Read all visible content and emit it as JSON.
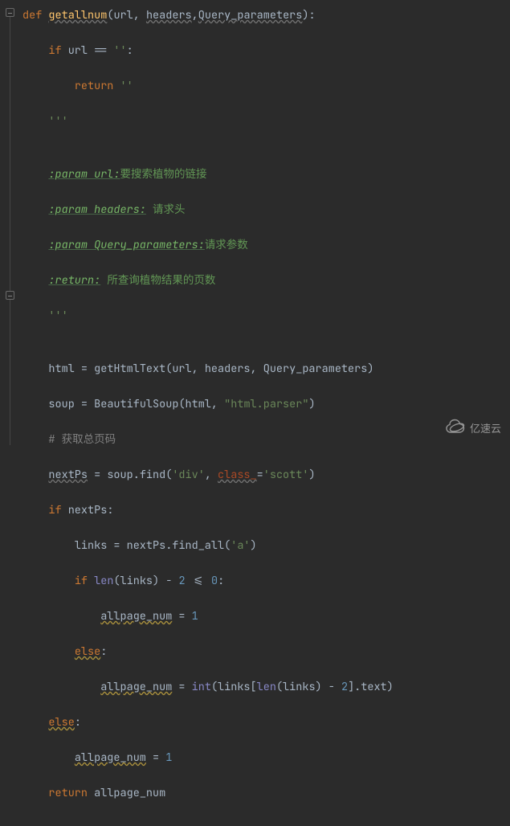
{
  "code": {
    "def": "def",
    "fn_name": "getallnum",
    "lp": "(",
    "p1": "url",
    "c1": ", ",
    "p2": "headers",
    "c2": ",",
    "p3": "Query_parameters",
    "rp": ")",
    "colon": ":",
    "if1_kw": "if",
    "if1_var": " url ",
    "if1_eq": "==",
    "if1_empty": " ''",
    "if1_colon": ":",
    "ret1_kw": "return",
    "ret1_val": " ''",
    "tq_open": "'''",
    "doc_l1_tag": ":param url:",
    "doc_l1_txt": "要搜索植物的链接",
    "doc_l2_tag": ":param headers:",
    "doc_l2_txt": " 请求头",
    "doc_l3_tag": ":param Query_parameters:",
    "doc_l3_txt": "请求参数",
    "doc_l4_tag": ":return:",
    "doc_l4_txt": " 所查询植物结果的页数",
    "tq_close": "'''",
    "as1_lhs": "html",
    "as1_eq": " = ",
    "as1_fn": "getHtmlText",
    "as1_args": "(url, headers, Query_parameters)",
    "as2_lhs": "soup",
    "as2_eq": " = ",
    "as2_fn": "BeautifulSoup",
    "as2_a1": "(html, ",
    "as2_str": "\"html.parser\"",
    "as2_a2": ")",
    "cmt1": "# 获取总页码",
    "as3_lhs": "nextPs",
    "as3_eq": " = soup.find(",
    "as3_s1": "'div'",
    "as3_c": ", ",
    "as3_kw": "class_",
    "as3_eqk": "=",
    "as3_s2": "'scott'",
    "as3_rp": ")",
    "if2_kw": "if",
    "if2_cond": " nextPs",
    "if2_colon": ":",
    "as4_lhs": "links",
    "as4_eq": " = nextPs.find_all(",
    "as4_s1": "'a'",
    "as4_rp": ")",
    "if3_kw": "if",
    "if3_sp": " ",
    "if3_len": "len",
    "if3_a": "(links) - ",
    "if3_n2": "2",
    "if3_le": " <= ",
    "if3_n0": "0",
    "if3_colon": ":",
    "as5_lhs": "allpage_num",
    "as5_eq": " = ",
    "as5_val": "1",
    "else1_kw": "else",
    "else1_colon": ":",
    "as6_lhs": "allpage_num",
    "as6_eq": " = ",
    "as6_int": "int",
    "as6_a1": "(links[",
    "as6_len": "len",
    "as6_a2": "(links) - ",
    "as6_n2": "2",
    "as6_a3": "].text)",
    "else2_kw": "else",
    "else2_colon": ":",
    "as7_lhs": "allpage_num",
    "as7_eq": " = ",
    "as7_val": "1",
    "ret2_kw": "return",
    "ret2_val": " allpage_num"
  },
  "watermark": {
    "text": "亿速云"
  }
}
